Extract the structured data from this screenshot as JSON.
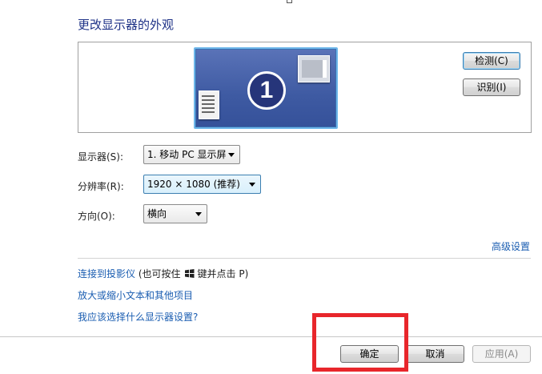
{
  "title": "更改显示器的外观",
  "preview": {
    "monitor_number": "1",
    "detect_button": "检测(C)",
    "identify_button": "识别(I)"
  },
  "display": {
    "label": "显示器(S):",
    "value": "1. 移动 PC 显示屏"
  },
  "resolution": {
    "label": "分辨率(R):",
    "value": "1920 × 1080 (推荐)"
  },
  "orientation": {
    "label": "方向(O):",
    "value": "横向"
  },
  "advanced_link": "高级设置",
  "links": {
    "projector_link": "连接到投影仪",
    "projector_hint_prefix": "(也可按住",
    "projector_hint_suffix": "键并点击 P)",
    "text_size_link": "放大或缩小文本和其他项目",
    "help_link": "我应该选择什么显示器设置?"
  },
  "footer": {
    "ok_button": "确定",
    "cancel_button": "取消",
    "apply_button": "应用(A)"
  },
  "colors": {
    "highlight_box": "#e8262b",
    "link": "#1a5db1",
    "title": "#1e3287"
  }
}
